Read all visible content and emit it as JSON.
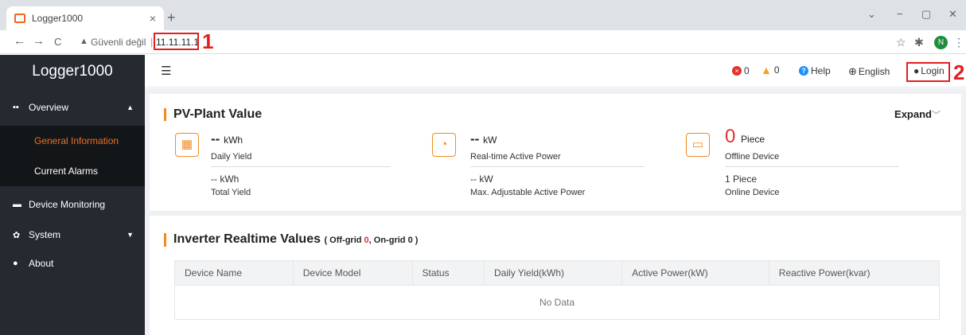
{
  "browser": {
    "tab_title": "Logger1000",
    "tab_close": "×",
    "new_tab": "+",
    "address_warning": "Güvenli değil",
    "address_separator": "|",
    "url": "11.11.11.1",
    "callout_1": "1",
    "callout_2": "2",
    "profile_initial": "N"
  },
  "sidebar": {
    "logo": "Logger1000",
    "overview": "Overview",
    "general_information": "General Information",
    "current_alarms": "Current Alarms",
    "device_monitoring": "Device Monitoring",
    "system": "System",
    "about": "About"
  },
  "header": {
    "error_count": "0",
    "warning_count": "0",
    "help": "Help",
    "language": "English",
    "login": "Login"
  },
  "pv_plant": {
    "title": "PV-Plant Value",
    "expand": "Expand",
    "daily_yield_value": "--",
    "daily_yield_unit": "kWh",
    "daily_yield_label": "Daily Yield",
    "total_yield_value": "-- kWh",
    "total_yield_label": "Total Yield",
    "active_power_value": "--",
    "active_power_unit": "kW",
    "active_power_label": "Real-time Active Power",
    "max_power_value": "-- kW",
    "max_power_label": "Max. Adjustable Active Power",
    "offline_value": "0",
    "offline_unit": "Piece",
    "offline_label": "Offline Device",
    "online_value": "1 Piece",
    "online_label": "Online Device"
  },
  "inverter": {
    "title": "Inverter Realtime Values",
    "subtitle_open": "( Off-grid ",
    "off_grid_count": "0",
    "subtitle_mid": ", On-grid ",
    "on_grid_count": "0",
    "subtitle_close": " )",
    "columns": [
      "Device Name",
      "Device Model",
      "Status",
      "Daily Yield(kWh)",
      "Active Power(kW)",
      "Reactive Power(kvar)"
    ],
    "empty_text": "No Data"
  },
  "colors": {
    "accent": "#f28b1f",
    "sidebar_bg": "#252a31",
    "active_nav": "#ee6f1f",
    "callout_red": "#e41e1e"
  }
}
